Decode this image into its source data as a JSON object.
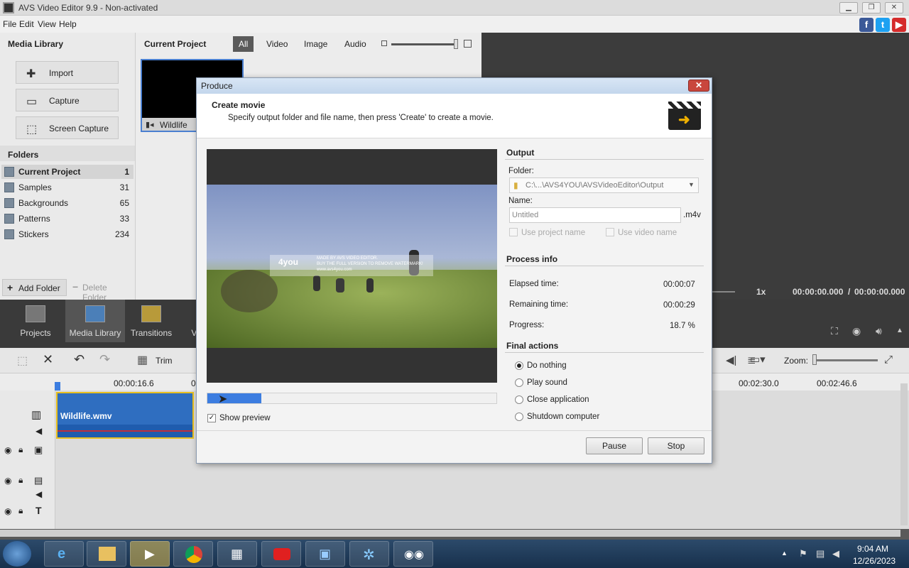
{
  "app": {
    "title": "AVS Video Editor 9.9 - Non-activated"
  },
  "menu": [
    "File",
    "Edit",
    "View",
    "Help"
  ],
  "media_library": {
    "header": "Media Library",
    "buttons": [
      {
        "label": "Import",
        "icon": "plus-icon"
      },
      {
        "label": "Capture",
        "icon": "webcam-icon"
      },
      {
        "label": "Screen Capture",
        "icon": "screen-icon"
      }
    ],
    "folders_header": "Folders",
    "folders": [
      {
        "name": "Current Project",
        "count": "1"
      },
      {
        "name": "Samples",
        "count": "31"
      },
      {
        "name": "Backgrounds",
        "count": "65"
      },
      {
        "name": "Patterns",
        "count": "33"
      },
      {
        "name": "Stickers",
        "count": "234"
      }
    ],
    "add_folder": "Add Folder",
    "delete_folder": "Delete Folder"
  },
  "project": {
    "header": "Current Project",
    "tabs": [
      "All",
      "Video",
      "Image",
      "Audio"
    ],
    "active_tab": "All",
    "media_item": "Wildlife"
  },
  "viewer": {
    "speed": "1x",
    "time": "00:00:00.000",
    "sep": "/",
    "duration": "00:00:00.000"
  },
  "nav": [
    "Projects",
    "Media Library",
    "Transitions",
    "Vid"
  ],
  "toolbar": {
    "trim": "Trim",
    "zoom": "Zoom:"
  },
  "ruler": {
    "t1": "00:00:16.6",
    "t2": "0",
    "t3": "00:02:30.0",
    "t4": "00:02:46.6"
  },
  "timeline": {
    "clip": "Wildlife.wmv"
  },
  "dialog": {
    "title": "Produce",
    "heading": "Create movie",
    "subheading": "Specify output folder and file name, then press 'Create' to create a movie.",
    "watermark": {
      "line1": "MADE BY AVS VIDEO EDITOR.",
      "line2": "BUY THE FULL VERSION TO REMOVE WATERMARK!",
      "line3": "www.avs4you.com",
      "logo": "4you"
    },
    "progress": 0.187,
    "show_preview": "Show preview",
    "output": {
      "header": "Output",
      "folder_label": "Folder:",
      "folder_value": "C:\\...\\AVS4YOU\\AVSVideoEditor\\Output",
      "name_label": "Name:",
      "name_value": "Untitled",
      "ext": ".m4v",
      "use_project_name": "Use project name",
      "use_video_name": "Use video name"
    },
    "process": {
      "header": "Process info",
      "elapsed_label": "Elapsed time:",
      "elapsed": "00:00:07",
      "remaining_label": "Remaining time:",
      "remaining": "00:00:29",
      "progress_label": "Progress:",
      "progress": "18.7 %"
    },
    "final": {
      "header": "Final actions",
      "options": [
        "Do nothing",
        "Play sound",
        "Close application",
        "Shutdown computer"
      ],
      "selected": 0
    },
    "pause": "Pause",
    "stop": "Stop"
  },
  "taskbar": {
    "time": "9:04 AM",
    "date": "12/26/2023"
  },
  "colors": {
    "accent": "#3c7de0",
    "clip": "#2f6ec0",
    "close": "#c9463d"
  }
}
